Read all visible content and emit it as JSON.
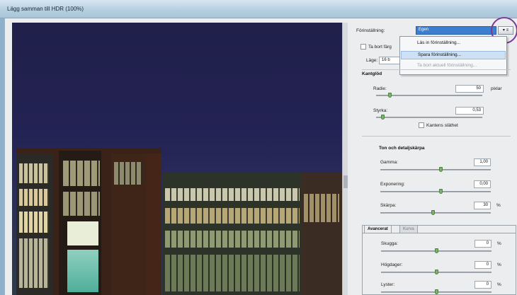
{
  "window": {
    "title": "Lägg samman till HDR (100%)"
  },
  "preview": {
    "image_alt": "night city buildings"
  },
  "panel": {
    "preset_label": "Förinställning:",
    "preset_value": "Egen",
    "menu_button": "▾ ≡",
    "remove_label": "Ta bort färg",
    "mode_label": "Läge:",
    "mode_value": "16 b",
    "dropdown": [
      {
        "label": "Läs in förinställning...",
        "state": "normal"
      },
      {
        "label": "Spara förinställning...",
        "state": "selected"
      },
      {
        "label": "Ta bort aktuell förinställning...",
        "state": "disabled"
      }
    ],
    "edge_glow": {
      "heading": "Kantglöd",
      "radius": {
        "label": "Radie:",
        "value": "50",
        "unit": "pixlar",
        "level": 0.12
      },
      "strength": {
        "label": "Styrka:",
        "value": "0,53",
        "level": 0.05
      },
      "smooth_label": "Kantens släthet"
    },
    "tone_detail": {
      "heading": "Ton och detaljskärpa",
      "gamma": {
        "label": "Gamma:",
        "value": "1,00",
        "level": 0.55
      },
      "exposure": {
        "label": "Exponering:",
        "value": "0,00",
        "level": 0.55
      },
      "detail": {
        "label": "Skärpa:",
        "value": "30",
        "unit": "%",
        "level": 0.48
      }
    },
    "tabs": {
      "advanced": "Avancerat",
      "curve": "Kurva"
    },
    "advanced": {
      "shadow": {
        "label": "Skugga:",
        "value": "0",
        "unit": "%",
        "level": 0.5
      },
      "highlight": {
        "label": "Högdager:",
        "value": "0",
        "unit": "%",
        "level": 0.5
      },
      "vibrance": {
        "label": "Lyster:",
        "value": "0",
        "unit": "%",
        "level": 0.5
      }
    }
  }
}
